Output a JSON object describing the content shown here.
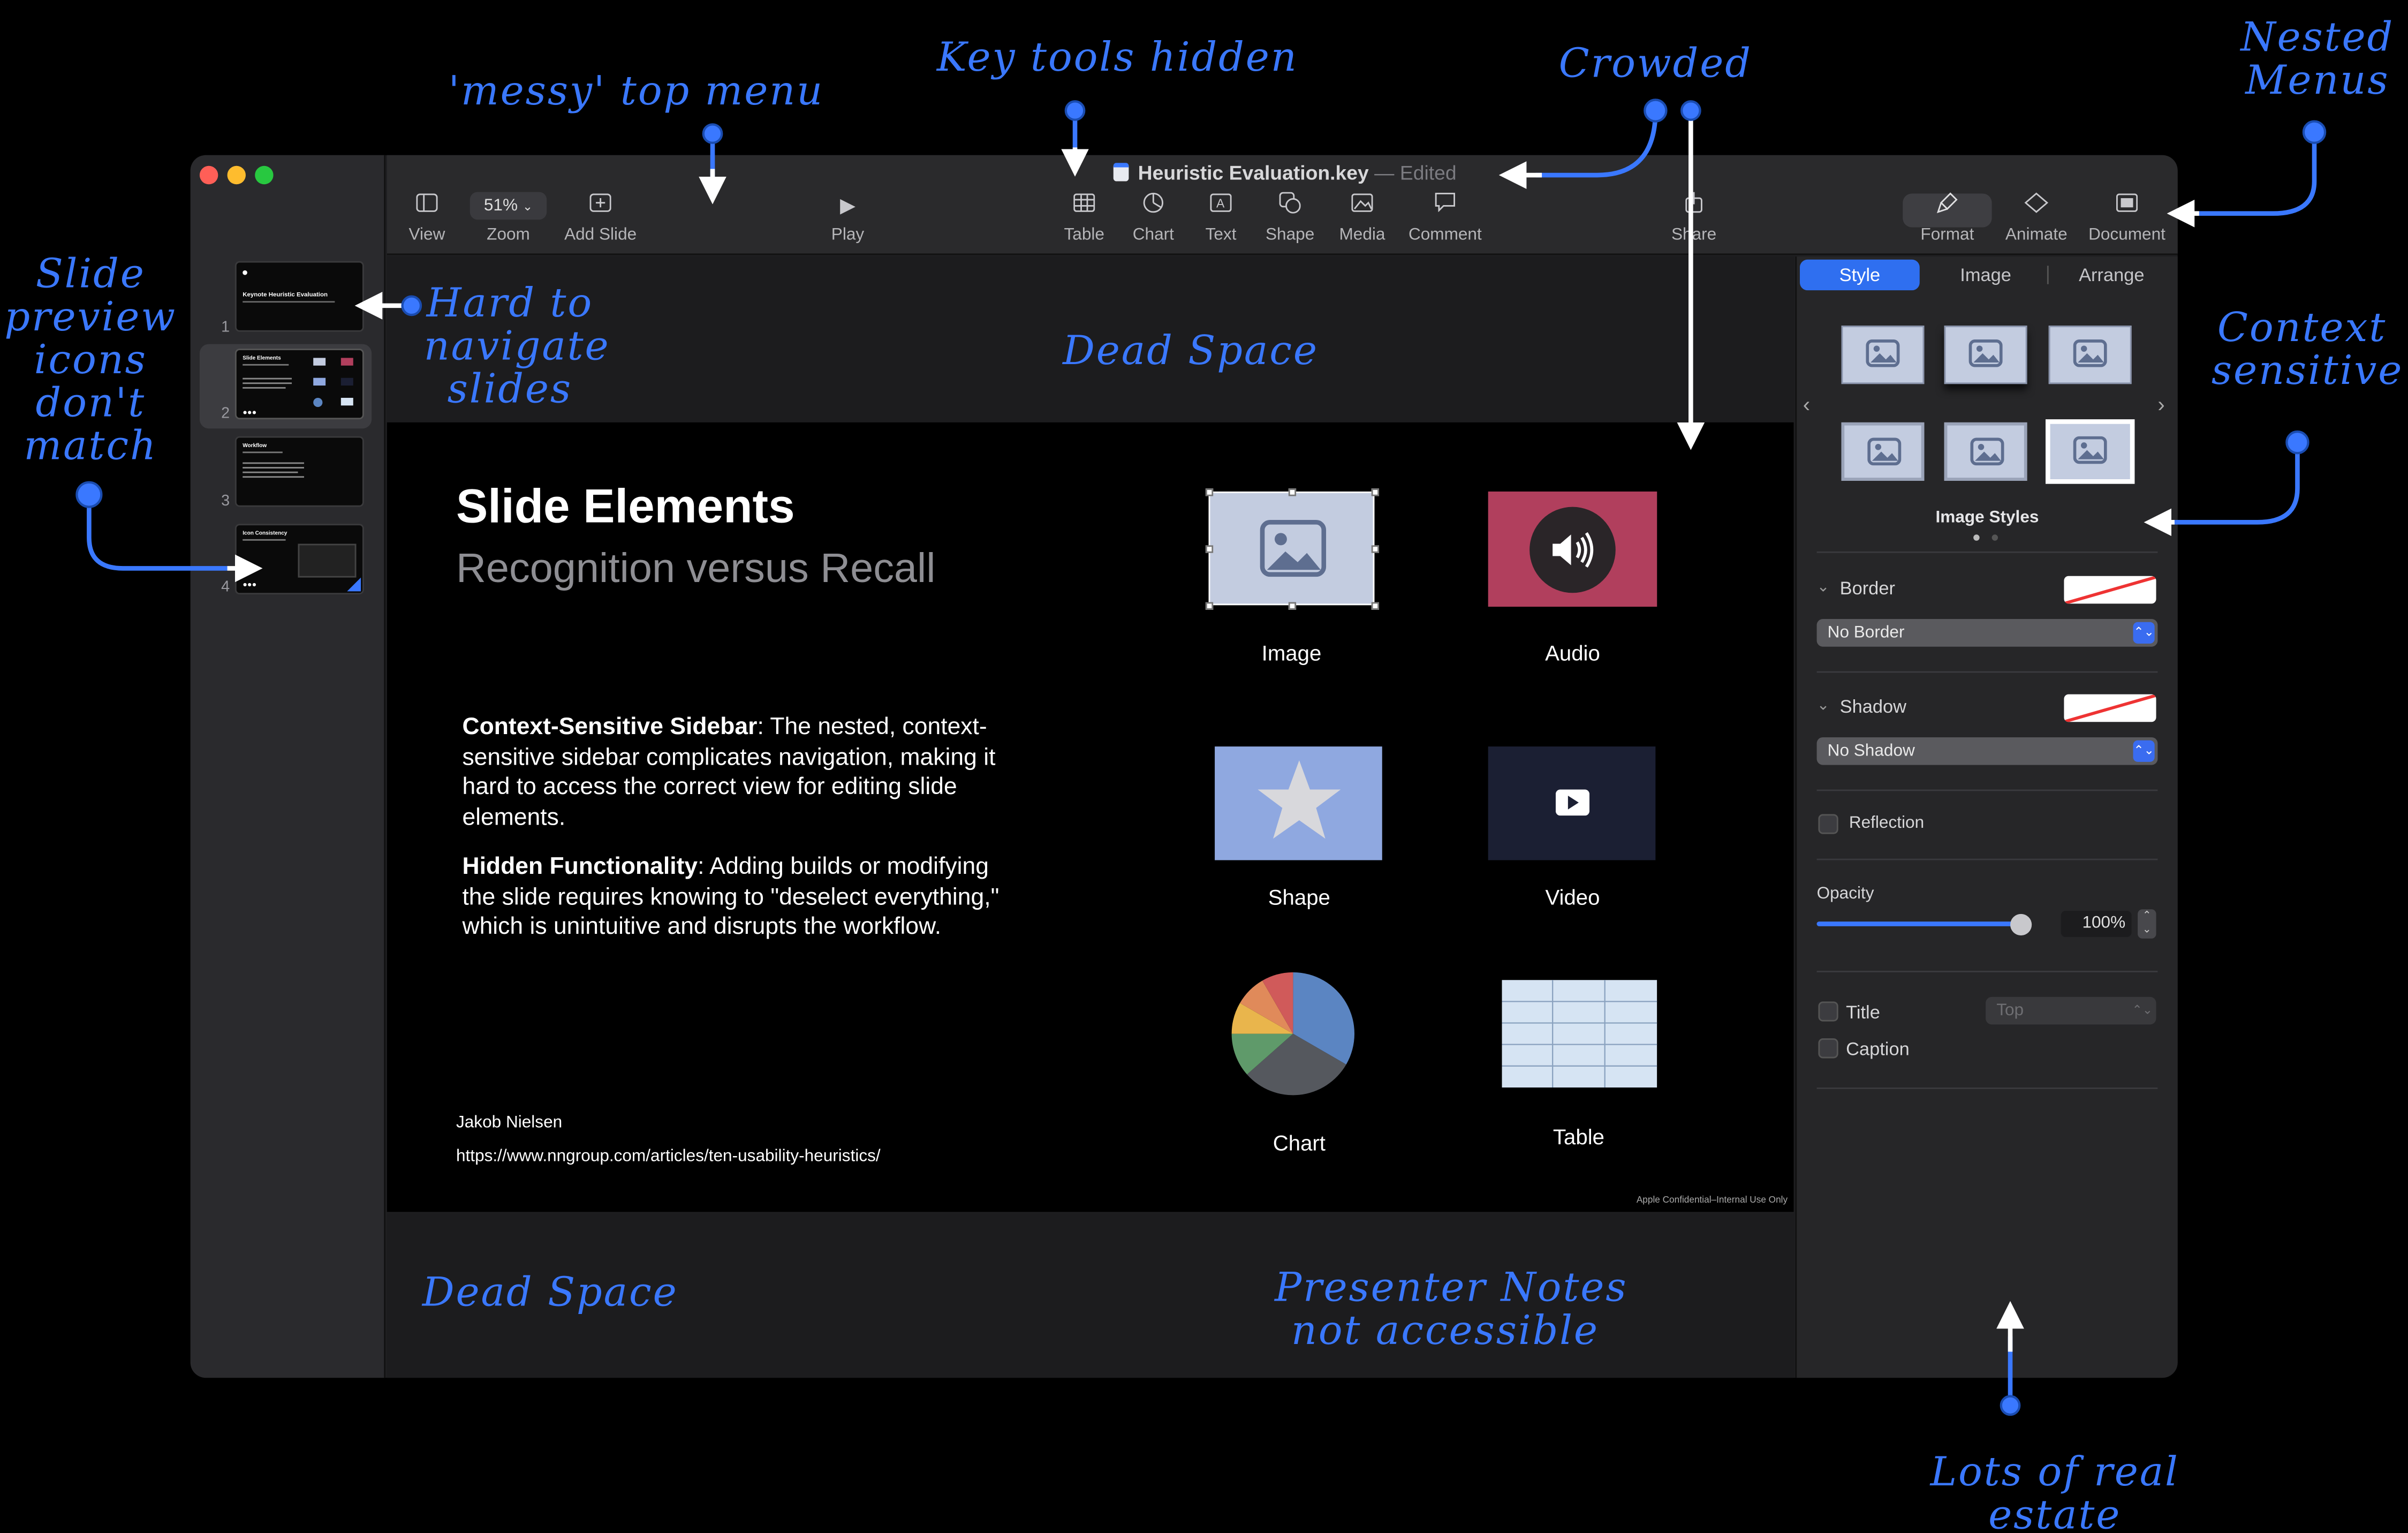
{
  "window": {
    "doc_name": "Heuristic Evaluation.key",
    "doc_status": "Edited"
  },
  "toolbar": {
    "view": "View",
    "zoom_value": "51%",
    "zoom": "Zoom",
    "add_slide": "Add Slide",
    "play": "Play",
    "table": "Table",
    "chart": "Chart",
    "text": "Text",
    "shape": "Shape",
    "media": "Media",
    "comment": "Comment",
    "share": "Share",
    "format": "Format",
    "animate": "Animate",
    "document": "Document"
  },
  "navigator": {
    "slides": [
      {
        "number": "1",
        "title": "Keynote Heuristic Evaluation"
      },
      {
        "number": "2",
        "title": "Slide Elements"
      },
      {
        "number": "3",
        "title": "Workflow"
      },
      {
        "number": "4",
        "title": "Icon Consistency"
      }
    ]
  },
  "slide": {
    "title": "Slide Elements",
    "subtitle": "Recognition versus Recall",
    "p1_bold": "Context-Sensitive Sidebar",
    "p1_text": ": The nested, context-sensitive sidebar complicates navigation, making it hard to access the correct view for editing slide elements.",
    "p2_bold": "Hidden Functionality",
    "p2_text": ": Adding builds or modifying the slide requires knowing to \"deselect everything,\" which is unintuitive and disrupts the workflow.",
    "author": "Jakob Nielsen",
    "url": "https://www.nngroup.com/articles/ten-usability-heuristics/",
    "footer": "Apple Confidential–Internal Use Only",
    "elements": {
      "image": "Image",
      "audio": "Audio",
      "shape": "Shape",
      "video": "Video",
      "chart": "Chart",
      "table": "Table"
    }
  },
  "inspector": {
    "tabs": [
      "Style",
      "Image",
      "Arrange"
    ],
    "active_tab": "Style",
    "image_styles_label": "Image Styles",
    "border_label": "Border",
    "border_value": "No Border",
    "shadow_label": "Shadow",
    "shadow_value": "No Shadow",
    "reflection_label": "Reflection",
    "opacity_label": "Opacity",
    "opacity_value": "100%",
    "opacity_fraction": 0.92,
    "title_label": "Title",
    "title_position": "Top",
    "caption_label": "Caption"
  },
  "annotations": {
    "messy_menu": "'messy' top menu",
    "key_tools": "Key tools hidden",
    "crowded": "Crowded",
    "nested_line1": "Nested",
    "nested_line2": "Menus",
    "slide_preview_line1": "Slide",
    "slide_preview_line2": "preview",
    "slide_preview_line3": "icons",
    "slide_preview_line4": "don't",
    "slide_preview_line5": "match",
    "hard_nav_line1": "Hard to",
    "hard_nav_line2": "navigate",
    "hard_nav_line3": "slides",
    "dead_space_top": "Dead Space",
    "context_line1": "Context",
    "context_line2": "sensitive",
    "dead_space_bottom": "Dead Space",
    "presenter_line1": "Presenter Notes",
    "presenter_line2": "not accessible",
    "real_estate_line1": "Lots of real",
    "real_estate_line2": "estate"
  },
  "colors": {
    "annotation": "#3a78ff",
    "accent": "#2f6ff0",
    "audio_tile": "#b13f5d",
    "video_tile": "#1b1f33"
  }
}
